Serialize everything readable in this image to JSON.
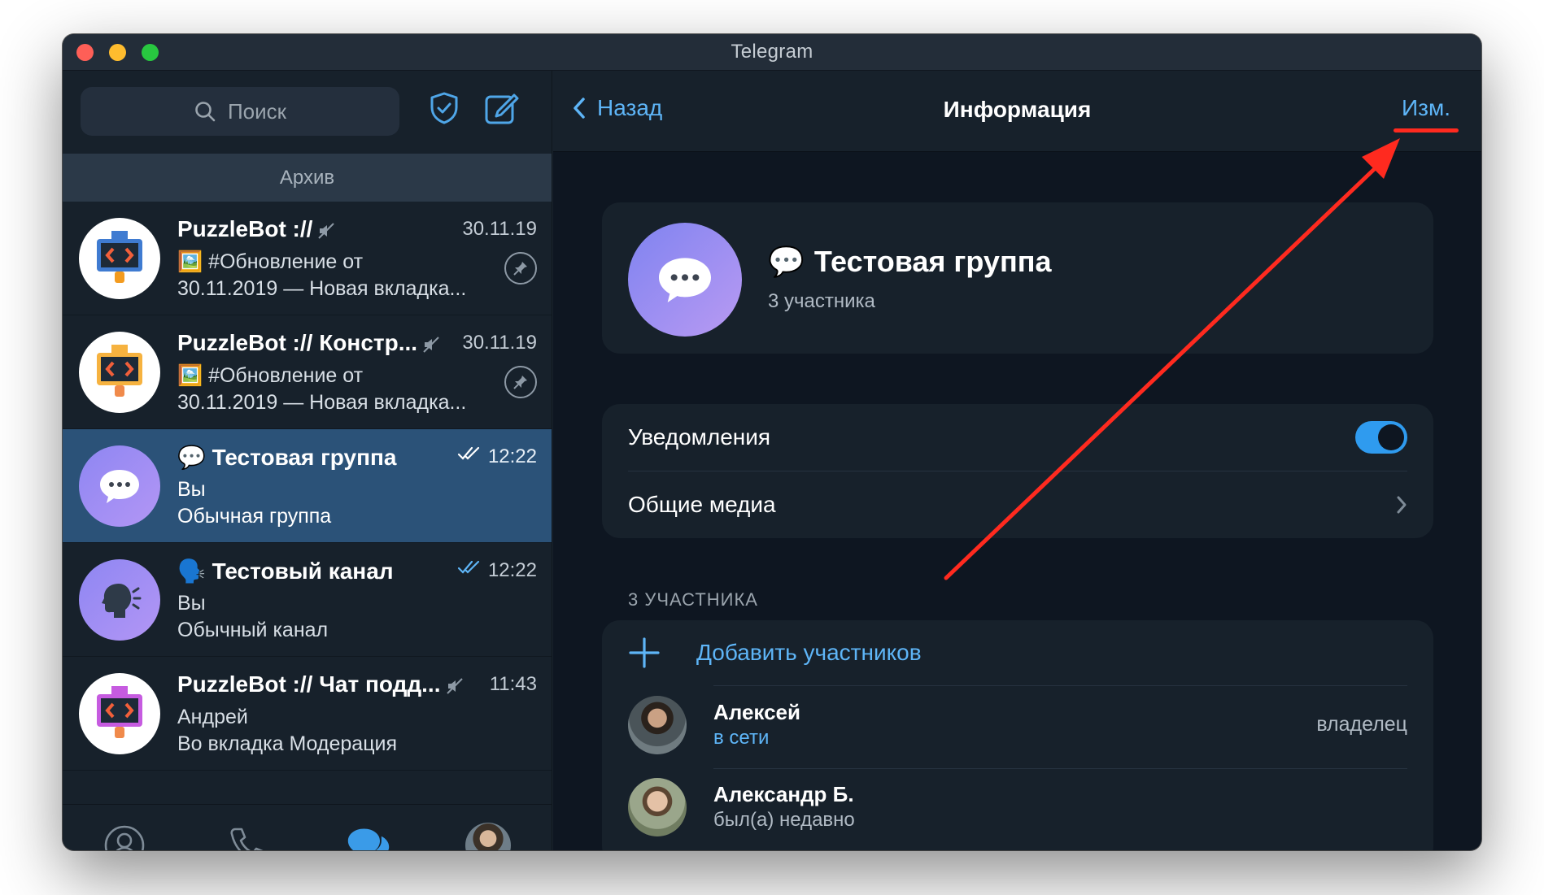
{
  "window": {
    "title": "Telegram"
  },
  "sidebar": {
    "search_placeholder": "Поиск",
    "archive_label": "Архив",
    "chats": [
      {
        "name": "PuzzleBot ://",
        "time": "30.11.19",
        "line2": "🖼️ #Обновление от",
        "line3": "30.11.2019 — Новая вкладка...",
        "muted": true,
        "pinned": true
      },
      {
        "name": "PuzzleBot :// Констр...",
        "time": "30.11.19",
        "line2": "🖼️ #Обновление от",
        "line3": "30.11.2019 — Новая вкладка...",
        "muted": true,
        "pinned": true
      },
      {
        "name": "💬 Тестовая группа",
        "time": "12:22",
        "line2": "Вы",
        "line3": "Обычная группа",
        "read": true,
        "active": true
      },
      {
        "name": "🗣️ Тестовый канал",
        "time": "12:22",
        "line2": "Вы",
        "line3": "Обычный канал",
        "read": true
      },
      {
        "name": "PuzzleBot :// Чат подд...",
        "time": "11:43",
        "line2": "Андрей",
        "line3": "Во вкладка Модерация",
        "muted": true
      }
    ],
    "nav": [
      "contacts-icon",
      "calls-icon",
      "chats-icon",
      "settings-avatar"
    ]
  },
  "info": {
    "back_label": "Назад",
    "title": "Информация",
    "edit_label": "Изм.",
    "group_emoji": "💬",
    "group_name": "Тестовая группа",
    "group_members": "3 участника",
    "notifications_label": "Уведомления",
    "notifications_on": true,
    "media_label": "Общие медиа",
    "members_section": "3 УЧАСТНИКА",
    "add_members_label": "Добавить участников",
    "members": [
      {
        "name": "Алексей",
        "status": "в сети",
        "role": "владелец"
      },
      {
        "name": "Александр Б.",
        "status": "был(а) недавно",
        "role": ""
      }
    ]
  },
  "colors": {
    "accent": "#5eb5f7",
    "annotation": "#ff2a1f",
    "active_chat": "#2b5278"
  }
}
